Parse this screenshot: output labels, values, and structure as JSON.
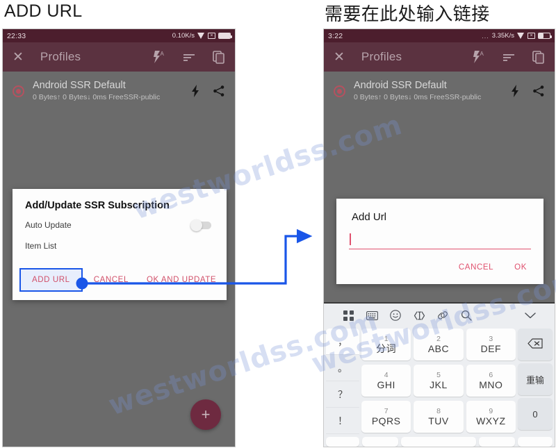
{
  "captions": {
    "left": "ADD URL",
    "right": "需要在此处输入链接"
  },
  "watermark": {
    "text": "westworldss.com"
  },
  "phone_left": {
    "statusbar": {
      "time": "22:33",
      "net_speed": "0.10K/s",
      "wifi_icon": "wifi-icon",
      "alarm_icon": "x-box-icon",
      "battery_icon": "battery-full-icon"
    },
    "appbar": {
      "close_icon": "close-icon",
      "title": "Profiles",
      "flash_icon": "flash-auto-icon",
      "sort_icon": "sort-icon",
      "copy_icon": "copy-icon"
    },
    "profile": {
      "name": "Android SSR Default",
      "subtitle": "0 Bytes↑ 0 Bytes↓ 0ms FreeSSR-public",
      "radio_icon": "radio-selected-icon",
      "bolt_icon": "bolt-icon",
      "share_icon": "share-icon"
    },
    "fab": {
      "label": "+",
      "icon": "plus-icon"
    },
    "dialog": {
      "title": "Add/Update SSR Subscription",
      "auto_update_label": "Auto Update",
      "auto_update_value": "off",
      "item_list_label": "Item List",
      "buttons": {
        "add_url": "ADD URL",
        "cancel": "CANCEL",
        "ok_and_update": "OK AND UPDATE"
      }
    }
  },
  "phone_right": {
    "statusbar": {
      "time": "3:22",
      "dots": "...",
      "net_speed": "3.35K/s",
      "wifi_icon": "wifi-icon",
      "alarm_icon": "x-box-icon",
      "battery_icon": "battery-half-icon"
    },
    "appbar": {
      "close_icon": "close-icon",
      "title": "Profiles",
      "flash_icon": "flash-auto-icon",
      "sort_icon": "sort-icon",
      "copy_icon": "copy-icon"
    },
    "profile": {
      "name": "Android SSR Default",
      "subtitle": "0 Bytes↑ 0 Bytes↓ 0ms FreeSSR-public",
      "radio_icon": "radio-selected-icon",
      "bolt_icon": "bolt-icon",
      "share_icon": "share-icon"
    },
    "dialog": {
      "title": "Add Url",
      "input_value": "",
      "input_placeholder": "",
      "buttons": {
        "cancel": "CANCEL",
        "ok": "OK"
      }
    },
    "keyboard": {
      "toolbar": [
        {
          "icon": "grid-apps-icon"
        },
        {
          "icon": "keyboard-icon"
        },
        {
          "icon": "emoji-icon"
        },
        {
          "icon": "cursor-move-icon"
        },
        {
          "icon": "clipboard-link-icon"
        },
        {
          "icon": "search-icon"
        },
        {
          "icon": "chevron-down-icon"
        }
      ],
      "side_keys": [
        "，",
        "。",
        "？",
        "！"
      ],
      "number_keys": [
        {
          "num": "1",
          "letters": "分词"
        },
        {
          "num": "2",
          "letters": "ABC"
        },
        {
          "num": "3",
          "letters": "DEF"
        },
        {
          "num": "4",
          "letters": "GHI"
        },
        {
          "num": "5",
          "letters": "JKL"
        },
        {
          "num": "6",
          "letters": "MNO"
        },
        {
          "num": "7",
          "letters": "PQRS"
        },
        {
          "num": "8",
          "letters": "TUV"
        },
        {
          "num": "9",
          "letters": "WXYZ"
        }
      ],
      "right_keys": [
        {
          "label": "",
          "icon": "backspace-icon"
        },
        {
          "label": "重输",
          "icon": ""
        },
        {
          "label": "0",
          "icon": ""
        }
      ]
    }
  },
  "annotation": {
    "arrow_color": "#1a56e8",
    "highlight_target": "ADD URL"
  }
}
